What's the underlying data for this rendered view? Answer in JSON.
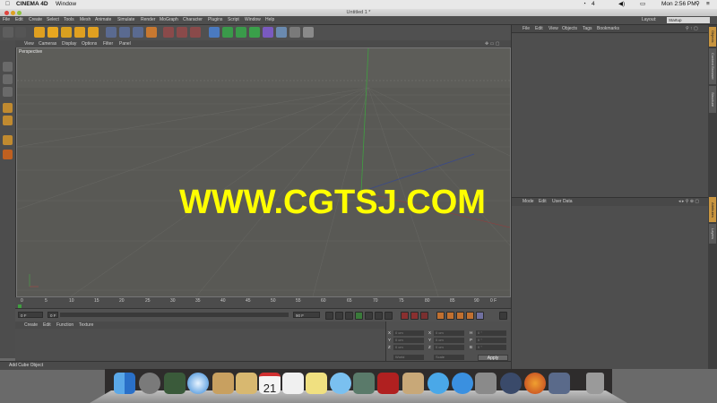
{
  "mac_menubar": {
    "app": "CINEMA 4D",
    "items": [
      "Window"
    ],
    "status": {
      "count": "4",
      "time": "Mon 2:56 PM"
    }
  },
  "window": {
    "title": "Untitled 1 *"
  },
  "c4d_menu": {
    "items": [
      "File",
      "Edit",
      "Create",
      "Select",
      "Tools",
      "Mesh",
      "Animate",
      "Simulate",
      "Render",
      "MoGraph",
      "Character",
      "Plugins",
      "Script",
      "Window",
      "Help"
    ],
    "layout_label": "Layout:",
    "layout_value": "Startup"
  },
  "viewport": {
    "menu": [
      "View",
      "Cameras",
      "Display",
      "Options",
      "Filter",
      "Panel"
    ],
    "label": "Perspective"
  },
  "watermark": "WWW.CGTSJ.COM",
  "timeline": {
    "ticks": [
      "0",
      "5",
      "10",
      "15",
      "20",
      "25",
      "30",
      "35",
      "40",
      "45",
      "50",
      "55",
      "60",
      "65",
      "70",
      "75",
      "80",
      "85",
      "90"
    ],
    "end_label": "0 F"
  },
  "transport": {
    "start_field": "0 F",
    "min_field": "0 F",
    "end_field": "90 F"
  },
  "material_manager": {
    "menu": [
      "Create",
      "Edit",
      "Function",
      "Texture"
    ]
  },
  "coordinates": {
    "rows": [
      {
        "axis": "X",
        "pos": "0 cm",
        "axis2": "X",
        "size": "0 cm",
        "axis3": "H",
        "rot": "0 °"
      },
      {
        "axis": "Y",
        "pos": "0 cm",
        "axis2": "Y",
        "size": "0 cm",
        "axis3": "P",
        "rot": "0 °"
      },
      {
        "axis": "Z",
        "pos": "0 cm",
        "axis2": "Z",
        "size": "0 cm",
        "axis3": "B",
        "rot": "0 °"
      }
    ],
    "mode1": "World",
    "mode2": "Scale",
    "apply": "Apply"
  },
  "status_bar": {
    "text": "Add Cube Object"
  },
  "object_manager": {
    "menu": [
      "File",
      "Edit",
      "View",
      "Objects",
      "Tags",
      "Bookmarks"
    ]
  },
  "attribute_manager": {
    "menu": [
      "Mode",
      "Edit",
      "User Data"
    ]
  },
  "right_tabs": [
    "Objects",
    "Content Browser",
    "Structure",
    "Attributes",
    "Layers"
  ],
  "dock": {
    "icons": [
      "finder-icon",
      "launchpad-icon",
      "mission-control-icon",
      "safari-icon",
      "stamp-icon",
      "calendar-icon",
      "reminders-icon",
      "notes-icon",
      "messages-icon",
      "facetime-icon",
      "photo-booth-icon",
      "preview-icon",
      "itunes-icon",
      "app-store-icon",
      "system-preferences-icon",
      "cinema4d-icon",
      "firefox-icon",
      "quicktime-icon",
      "trash-icon"
    ],
    "calendar_day": "21"
  }
}
